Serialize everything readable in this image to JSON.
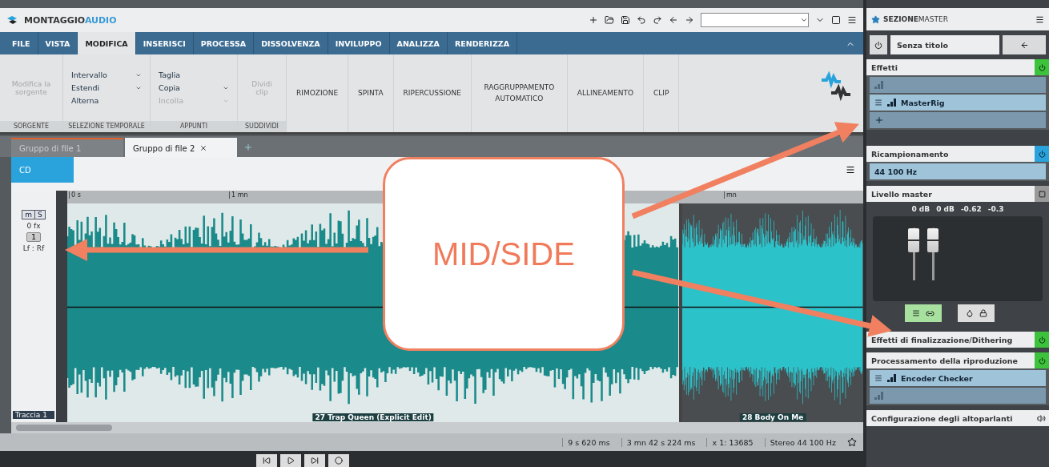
{
  "window": {
    "title_main": "MONTAGGIO",
    "title_accent": "AUDIO"
  },
  "ribbon_tabs": [
    {
      "label": "FILE",
      "selected": false
    },
    {
      "label": "VISTA",
      "selected": false
    },
    {
      "label": "MODIFICA",
      "selected": true
    },
    {
      "label": "INSERISCI",
      "selected": false
    },
    {
      "label": "PROCESSA",
      "selected": false
    },
    {
      "label": "DISSOLVENZA",
      "selected": false
    },
    {
      "label": "INVILUPPO",
      "selected": false
    },
    {
      "label": "ANALIZZA",
      "selected": false
    },
    {
      "label": "RENDERIZZA",
      "selected": false
    }
  ],
  "ribbon_groups": [
    {
      "label": "SORGENTE",
      "kind": "large",
      "items": [
        {
          "label": "Modifica la sorgente",
          "disabled": true
        }
      ]
    },
    {
      "label": "SELEZIONE TEMPORALE",
      "kind": "list",
      "items": [
        {
          "label": "Intervallo",
          "disabled": false,
          "dropdown": true
        },
        {
          "label": "Estendi",
          "disabled": false,
          "dropdown": true
        },
        {
          "label": "Alterna",
          "disabled": false,
          "dropdown": false
        }
      ]
    },
    {
      "label": "APPUNTI",
      "kind": "list",
      "items": [
        {
          "label": "Taglia",
          "disabled": false,
          "dropdown": false
        },
        {
          "label": "Copia",
          "disabled": false,
          "dropdown": true
        },
        {
          "label": "Incolla",
          "disabled": true,
          "dropdown": true
        }
      ]
    },
    {
      "label": "SUDDIVIDI",
      "kind": "large",
      "items": [
        {
          "label": "Dividi clip",
          "disabled": true
        }
      ]
    }
  ],
  "menu_buttons": [
    "RIMOZIONE",
    "SPINTA",
    "RIPERCUSSIONE",
    "RAGGRUPPAMENTO AUTOMATICO",
    "ALLINEAMENTO",
    "CLIP"
  ],
  "file_tabs": [
    {
      "label": "Gruppo di file 1",
      "selected": false
    },
    {
      "label": "Gruppo di file 2",
      "selected": true
    }
  ],
  "montage_toolbar": {
    "label": "CD"
  },
  "ruler": [
    "0 s",
    "1 mn",
    "mn"
  ],
  "track": {
    "name": "Traccia 1",
    "mute": "m",
    "solo": "S",
    "fx": "0 fx",
    "number": "1",
    "routing": "Lf : Rf"
  },
  "clips": [
    {
      "name": "27 Trap Queen (Explicit Edit)",
      "color": "#1a8a8a"
    },
    {
      "name": "28 Body On Me",
      "color": "#2cc2ca"
    }
  ],
  "status_bar": [
    "9 s 620 ms",
    "3 mn 42 s 224 ms",
    "x 1: 13685",
    "Stereo 44 100 Hz"
  ],
  "callout": {
    "text": "MID/SIDE"
  },
  "master": {
    "title_main": "SEZIONE",
    "title_accent": "MASTER",
    "preset": "Senza titolo",
    "effects": {
      "label": "Effetti",
      "on": true,
      "slots": [
        {
          "active": false
        },
        {
          "name": "MasterRig",
          "active": true
        }
      ]
    },
    "resampling": {
      "label": "Ricampionamento",
      "on": true,
      "value": "44 100 Hz"
    },
    "level": {
      "label": "Livello master",
      "readings": [
        "0 dB",
        "0 dB",
        "-0.62",
        "-0.3"
      ],
      "faders": [
        {
          "level": 0.92
        },
        {
          "level": 0.92
        }
      ],
      "link_on": true
    },
    "finalizing": {
      "label": "Effetti di finalizzazione/Dithering",
      "on": true
    },
    "playback": {
      "label": "Processamento della riproduzione",
      "on": true,
      "slots": [
        {
          "name": "Encoder Checker",
          "active": true
        },
        {
          "active": false
        }
      ]
    },
    "speakers": {
      "label": "Configurazione degli altoparlanti"
    }
  }
}
